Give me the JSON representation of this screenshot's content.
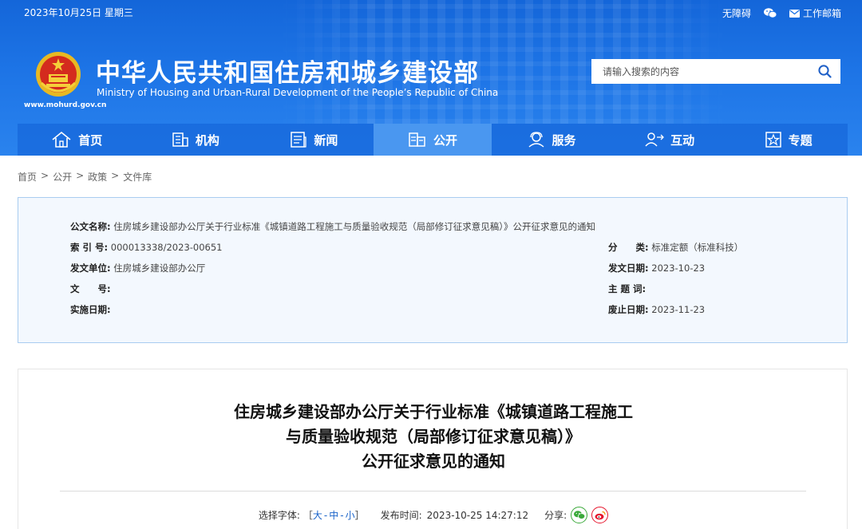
{
  "topbar": {
    "date": "2023年10月25日 星期三",
    "accessibility": "无障碍",
    "mail": "工作邮箱"
  },
  "site": {
    "title": "中华人民共和国住房和城乡建设部",
    "subtitle": "Ministry of Housing and Urban-Rural Development of the People’s Republic of China",
    "url": "www.mohurd.gov.cn"
  },
  "search": {
    "placeholder": "请输入搜索的内容"
  },
  "nav": [
    {
      "label": "首页",
      "icon": "home-icon"
    },
    {
      "label": "机构",
      "icon": "building-icon"
    },
    {
      "label": "新闻",
      "icon": "news-icon"
    },
    {
      "label": "公开",
      "icon": "public-icon",
      "active": true
    },
    {
      "label": "服务",
      "icon": "service-icon"
    },
    {
      "label": "互动",
      "icon": "interact-icon"
    },
    {
      "label": "专题",
      "icon": "topic-icon"
    }
  ],
  "breadcrumb": [
    "首页",
    "公开",
    "政策",
    "文件库"
  ],
  "meta": {
    "name_label": "公文名称:",
    "name_value": "住房城乡建设部办公厅关于行业标准《城镇道路工程施工与质量验收规范（局部修订征求意见稿）》公开征求意见的通知",
    "index_label": "索 引 号:",
    "index_value": "000013338/2023-00651",
    "category_label": "分　　类:",
    "category_value": "标准定额（标准科技）",
    "issuer_label": "发文单位:",
    "issuer_value": "住房城乡建设部办公厅",
    "issue_date_label": "发文日期:",
    "issue_date_value": "2023-10-23",
    "docno_label": "文　　号:",
    "docno_value": "",
    "keywords_label": "主 题 词:",
    "keywords_value": "",
    "effective_label": "实施日期:",
    "effective_value": "",
    "expire_label": "废止日期:",
    "expire_value": "2023-11-23"
  },
  "article": {
    "title_line1": "住房城乡建设部办公厅关于行业标准《城镇道路工程施工",
    "title_line2": "与质量验收规范（局部修订征求意见稿）》",
    "title_line3": "公开征求意见的通知",
    "font_label": "选择字体:",
    "font_open": "［",
    "font_large": "大",
    "font_medium": "中",
    "font_small": "小",
    "font_close": "］",
    "publish_label": "发布时间:",
    "publish_time": "2023-10-25 14:27:12",
    "share_label": "分享:"
  },
  "colors": {
    "header_blue": "#1d74e6",
    "nav_active": "#4a97f0",
    "link_blue": "#1a63c9",
    "wechat_green": "#3aa93a",
    "weibo_red": "#e6162d"
  }
}
